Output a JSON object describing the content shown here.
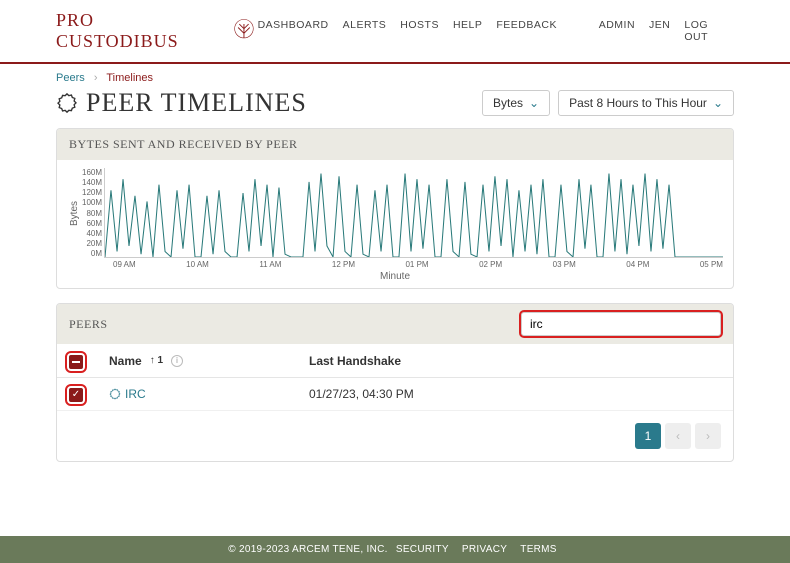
{
  "brand": "PRO CUSTODIBUS",
  "nav": {
    "dashboard": "DASHBOARD",
    "alerts": "ALERTS",
    "hosts": "HOSTS",
    "help": "HELP",
    "feedback": "FEEDBACK",
    "admin": "ADMIN",
    "user": "JEN",
    "logout": "LOG OUT"
  },
  "crumbs": {
    "peers": "Peers",
    "timelines": "Timelines"
  },
  "title": "PEER TIMELINES",
  "dropdowns": {
    "metric": "Bytes",
    "range": "Past 8 Hours to This Hour"
  },
  "chart": {
    "title": "BYTES SENT AND RECEIVED BY PEER",
    "ylabel": "Bytes",
    "xlabel": "Minute",
    "yticks": [
      "160M",
      "140M",
      "120M",
      "100M",
      "80M",
      "60M",
      "40M",
      "20M",
      "0M"
    ],
    "xticks": [
      "09 AM",
      "10 AM",
      "11 AM",
      "12 PM",
      "01 PM",
      "02 PM",
      "03 PM",
      "04 PM",
      "05 PM"
    ]
  },
  "chart_data": {
    "type": "line",
    "ylabel": "Bytes",
    "xlabel": "Minute",
    "ylim": [
      0,
      160
    ],
    "x_hours": [
      "09 AM",
      "10 AM",
      "11 AM",
      "12 PM",
      "01 PM",
      "02 PM",
      "03 PM",
      "04 PM",
      "05 PM"
    ],
    "series": [
      {
        "name": "IRC",
        "unit": "M bytes",
        "values": [
          0,
          120,
          10,
          140,
          20,
          110,
          5,
          100,
          0,
          130,
          10,
          0,
          120,
          15,
          130,
          0,
          0,
          110,
          5,
          120,
          10,
          0,
          0,
          115,
          10,
          140,
          20,
          130,
          0,
          125,
          5,
          0,
          0,
          0,
          135,
          10,
          150,
          20,
          0,
          145,
          10,
          0,
          130,
          5,
          0,
          120,
          10,
          130,
          0,
          0,
          150,
          10,
          140,
          15,
          130,
          0,
          0,
          140,
          10,
          0,
          135,
          5,
          0,
          130,
          10,
          145,
          20,
          140,
          0,
          120,
          10,
          130,
          5,
          140,
          0,
          0,
          130,
          10,
          0,
          140,
          15,
          130,
          0,
          0,
          150,
          10,
          140,
          5,
          130,
          20,
          150,
          10,
          140,
          15,
          130,
          0,
          0,
          0,
          0,
          0,
          0,
          0,
          0,
          0
        ]
      }
    ]
  },
  "peers": {
    "title": "PEERS",
    "search_value": "irc",
    "cols": {
      "name": "Name",
      "sort": "↑ 1",
      "handshake": "Last Handshake"
    },
    "rows": [
      {
        "name": "IRC",
        "handshake": "01/27/23, 04:30 PM"
      }
    ]
  },
  "pager": {
    "page": "1"
  },
  "footer": {
    "copyright": "© 2019-2023 ARCEM TENE, INC.",
    "security": "SECURITY",
    "privacy": "PRIVACY",
    "terms": "TERMS"
  }
}
